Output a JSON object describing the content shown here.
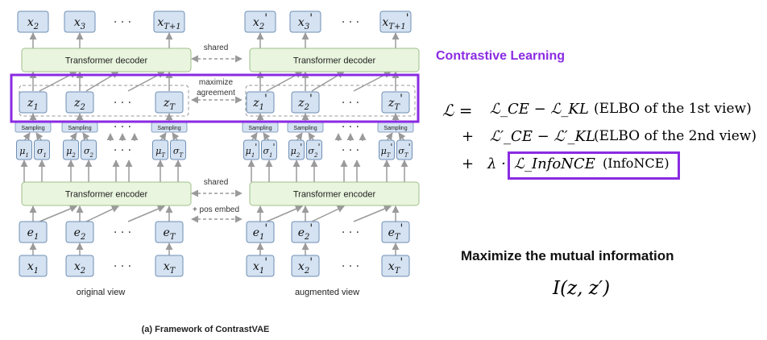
{
  "colors": {
    "token_fill": "#d4e2f2",
    "token_stroke": "#6f8fb4",
    "block_fill": "#e9f5de",
    "block_stroke": "#9fbf8a",
    "highlight": "#8a2be2",
    "arrow": "#9a9a9a"
  },
  "left": {
    "outputs": [
      "x_2",
      "x_3",
      "x_{T+1}"
    ],
    "decoder_label": "Transformer decoder",
    "latents": [
      "z_1",
      "z_2",
      "z_T"
    ],
    "sampling_label": "Sampling",
    "mu_sigma": [
      [
        "μ_1",
        "σ_1"
      ],
      [
        "μ_2",
        "σ_2"
      ],
      [
        "μ_T",
        "σ_T"
      ]
    ],
    "encoder_label": "Transformer encoder",
    "embeds": [
      "e_1",
      "e_2",
      "e_T"
    ],
    "inputs": [
      "x_1",
      "x_2",
      "x_T"
    ],
    "caption": "original view"
  },
  "right": {
    "outputs": [
      "x_2'",
      "x_3'",
      "x_{T+1}'"
    ],
    "decoder_label": "Transformer decoder",
    "latents": [
      "z_1'",
      "z_2'",
      "z_T'"
    ],
    "sampling_label": "Sampling",
    "mu_sigma": [
      [
        "μ_1'",
        "σ_1'"
      ],
      [
        "μ_2'",
        "σ_2'"
      ],
      [
        "μ_T'",
        "σ_T'"
      ]
    ],
    "encoder_label": "Transformer encoder",
    "embeds": [
      "e_1'",
      "e_2'",
      "e_T'"
    ],
    "inputs": [
      "x_1'",
      "x_2'",
      "x_T'"
    ],
    "caption": "augmented view"
  },
  "ellipsis": "· · ·",
  "shared_label": "shared",
  "maximize_label_line1": "maximize",
  "maximize_label_line2": "agreement",
  "pos_embed_label": "+ pos embed",
  "figure_caption": "(a) Framework of ContrastVAE",
  "panel": {
    "heading": "Contrastive Learning",
    "loss_lhs": "ℒ =",
    "line1_math": "ℒ_CE − ℒ_KL",
    "line1_note": "(ELBO of the 1st view)",
    "line2_op": "+",
    "line2_math": "ℒ′_CE − ℒ′_KL",
    "line2_note": "(ELBO of the 2nd view)",
    "line3_op": "+",
    "line3_lambda": "λ ·",
    "line3_math": "ℒ_InfoNCE",
    "line3_note": "(InfoNCE)",
    "mi_heading": "Maximize the mutual information",
    "mi_formula": "I(z, z′)"
  }
}
